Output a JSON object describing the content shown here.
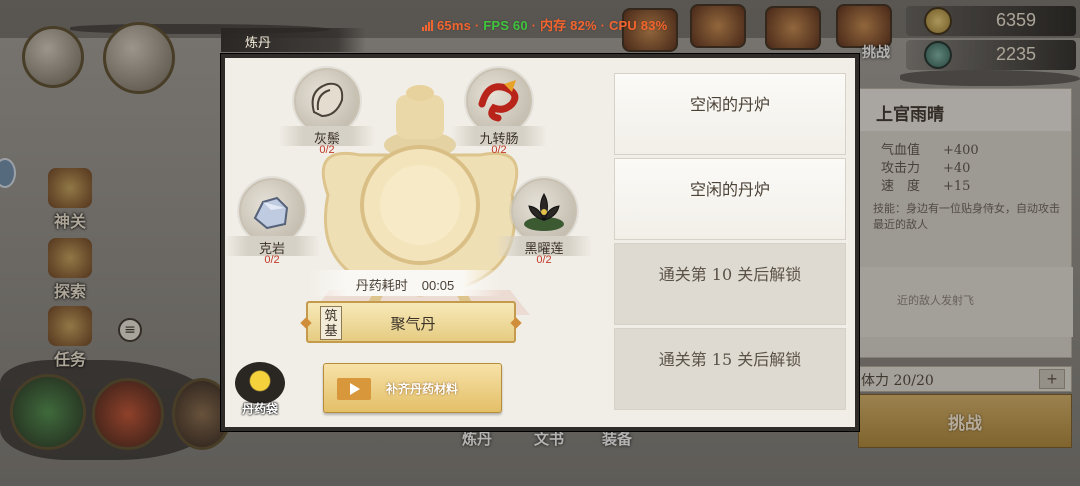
{
  "status": {
    "ping": "65ms",
    "fps": "FPS 60",
    "mem": "内存 82%",
    "cpu": "CPU 83%"
  },
  "currency": {
    "gold": "6359",
    "jade": "2235"
  },
  "side_nav": [
    {
      "label": "神关",
      "icon": "gate-icon"
    },
    {
      "label": "探索",
      "icon": "explore-icon"
    },
    {
      "label": "任务",
      "icon": "scroll-icon"
    }
  ],
  "top_icons": [
    "ornament-icon",
    "ornament-icon",
    "ornament-icon",
    "ornament-icon"
  ],
  "top_fragments": [
    "挑战"
  ],
  "bottom_fragments": [
    "炼丹",
    "文书",
    "装备"
  ],
  "hero_panel": {
    "name": "上官雨晴",
    "stats": [
      {
        "label": "气血值",
        "value": "+400"
      },
      {
        "label": "攻击力",
        "value": "+40"
      },
      {
        "label": "速　度",
        "value": "+15"
      }
    ],
    "skill": "技能：身边有一位贴身侍女，自动攻击最近的敌人",
    "skill2": "近的敌人发射飞",
    "stamina": "体力 20/20",
    "stamina_plus": "+",
    "challenge": "挑战"
  },
  "dialog": {
    "title": "炼丹",
    "ingredients": [
      {
        "name": "灰鬃",
        "count": "0/2",
        "icon": "gray-fur-icon"
      },
      {
        "name": "九转肠",
        "count": "0/2",
        "icon": "red-intestine-icon"
      },
      {
        "name": "克岩",
        "count": "0/2",
        "icon": "rock-crystal-icon"
      },
      {
        "name": "黑曜莲",
        "count": "0/2",
        "icon": "black-lotus-icon"
      }
    ],
    "time_label": "丹药耗时",
    "time_value": "00:05",
    "pill_tier": "筑基",
    "pill_name": "聚气丹",
    "pill_bag": "丹药袋",
    "refill_button": "补齐丹药材料",
    "furnace_slots": [
      {
        "text": "空闲的丹炉",
        "state": "idle"
      },
      {
        "text": "空闲的丹炉",
        "state": "idle"
      },
      {
        "text": "通关第 10 关后解锁",
        "state": "locked"
      },
      {
        "text": "通关第 15 关后解锁",
        "state": "locked"
      }
    ]
  },
  "colors": {
    "accent_gold": "#e3bf68",
    "count_red": "#c23a2a",
    "fps_green": "#3fc53d",
    "stat_orange": "#f3642e"
  }
}
